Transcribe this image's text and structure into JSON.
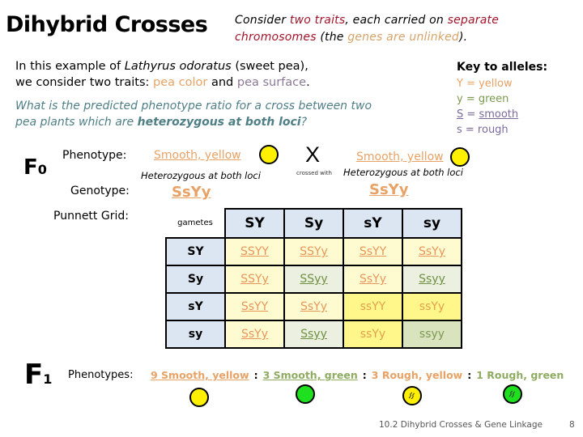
{
  "title": "Dihybrid Crosses",
  "intro": {
    "p1": "Consider ",
    "p2": "two traits",
    "p3": ", each carried on ",
    "p4": "separate chromosomes",
    "p5": " (the ",
    "p6": "genes are unlinked",
    "p7": ")."
  },
  "para": {
    "a1": "In this example of ",
    "a2": "Lathyrus odoratus",
    "a3": " (sweet pea),",
    "b1": "we consider two traits: ",
    "b2": "pea color",
    "b3": " and ",
    "b4": "pea surface",
    "b5": "."
  },
  "question": {
    "q1": "What is the predicted phenotype ratio for a cross between two pea plants which are ",
    "q2": "heterozygous at both loci",
    "q3": "?"
  },
  "key": {
    "title": "Key to alleles:",
    "items": [
      "Y = yellow",
      "y = green",
      "smooth",
      "s = rough"
    ],
    "s_letter": "S",
    "s_eq": " = "
  },
  "f0": {
    "label": "F",
    "sub": "0",
    "phenotype_label": "Phenotype:",
    "genotype_label": "Genotype:",
    "punnett_label": "Punnett Grid:",
    "parent1": {
      "phenotype": "Smooth, yellow",
      "note": "Heterozygous at both loci",
      "genotype": "SsYy",
      "pea": "yellow-smooth"
    },
    "parent2": {
      "phenotype": "Smooth, yellow",
      "note": "Heterozygous at both loci",
      "genotype": "SsYy",
      "pea": "yellow-smooth"
    },
    "cross_symbol": "X",
    "cross_label": "crossed with"
  },
  "punnett": {
    "corner": "gametes",
    "cols": [
      "SY",
      "Sy",
      "sY",
      "sy"
    ],
    "rows": [
      {
        "gamete": "SY",
        "cells": [
          "SSYY",
          "SSYy",
          "SsYY",
          "SsYy"
        ],
        "types": [
          "sy",
          "sy",
          "sy",
          "sy"
        ]
      },
      {
        "gamete": "Sy",
        "cells": [
          "SSYy",
          "SSyy",
          "SsYy",
          "Ssyy"
        ],
        "types": [
          "sy",
          "sg",
          "sy",
          "sg"
        ]
      },
      {
        "gamete": "sY",
        "cells": [
          "SsYY",
          "SsYy",
          "ssYY",
          "ssYy"
        ],
        "types": [
          "sy",
          "sy",
          "ry",
          "ry"
        ]
      },
      {
        "gamete": "sy",
        "cells": [
          "SsYy",
          "Ssyy",
          "ssYy",
          "ssyy"
        ],
        "types": [
          "sy",
          "sg",
          "ry",
          "rg"
        ]
      }
    ]
  },
  "f1": {
    "label": "F",
    "sub": "1",
    "phenotypes_label": "Phenotypes:",
    "ratio": [
      {
        "text": "9  Smooth, yellow",
        "count": 9,
        "pea": "yellow-smooth"
      },
      {
        "text": "3 Smooth, green",
        "count": 3,
        "pea": "green-smooth"
      },
      {
        "text": "3 Rough, yellow",
        "count": 3,
        "pea": "yellow-rough"
      },
      {
        "text": "1 Rough, green",
        "count": 1,
        "pea": "green-rough"
      }
    ],
    "separator": ":"
  },
  "footer": {
    "text": "10.2 Dihybrid Crosses & Gene Linkage",
    "page": "8"
  }
}
